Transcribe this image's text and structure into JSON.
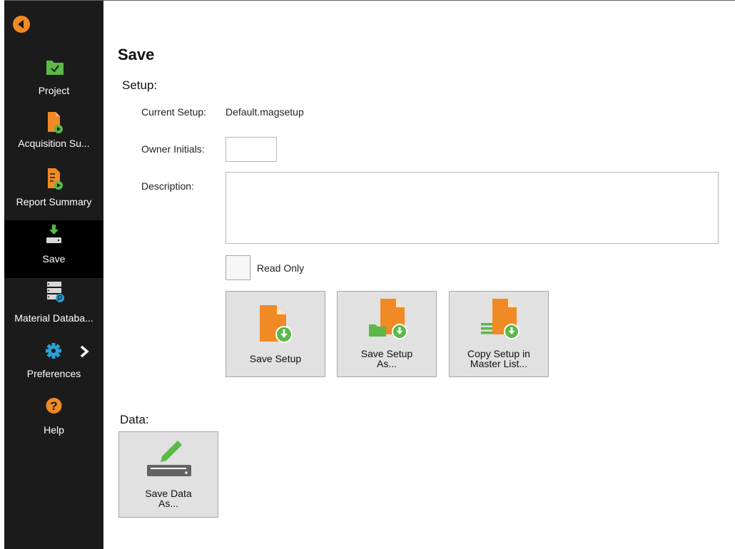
{
  "sidebar": {
    "items": [
      {
        "label": "Project",
        "icon": "folder-check-icon"
      },
      {
        "label": "Acquisition Su...",
        "icon": "document-play-icon"
      },
      {
        "label": "Report Summary",
        "icon": "report-play-icon"
      },
      {
        "label": "Save",
        "icon": "download-drive-icon",
        "active": true
      },
      {
        "label": "Material Databa...",
        "icon": "database-search-icon"
      },
      {
        "label": "Preferences",
        "icon": "gear-icon"
      },
      {
        "label": "Help",
        "icon": "question-icon"
      }
    ]
  },
  "page": {
    "title": "Save"
  },
  "setup": {
    "heading": "Setup:",
    "current_setup_label": "Current Setup:",
    "current_setup_value": "Default.magsetup",
    "owner_label": "Owner Initials:",
    "owner_value": "",
    "description_label": "Description:",
    "description_value": "",
    "read_only_label": "Read Only",
    "buttons": [
      {
        "line1": "Save Setup",
        "line2": ""
      },
      {
        "line1": "Save Setup",
        "line2": "As..."
      },
      {
        "line1": "Copy Setup in",
        "line2": "Master List..."
      }
    ]
  },
  "data": {
    "heading": "Data:",
    "save_data_line1": "Save Data",
    "save_data_line2": "As..."
  },
  "colors": {
    "accent": "#f08a24",
    "green": "#5cb848",
    "blue": "#2aa0d8",
    "sidebar": "#1b1b1b",
    "tile": "#e1e1e1"
  }
}
